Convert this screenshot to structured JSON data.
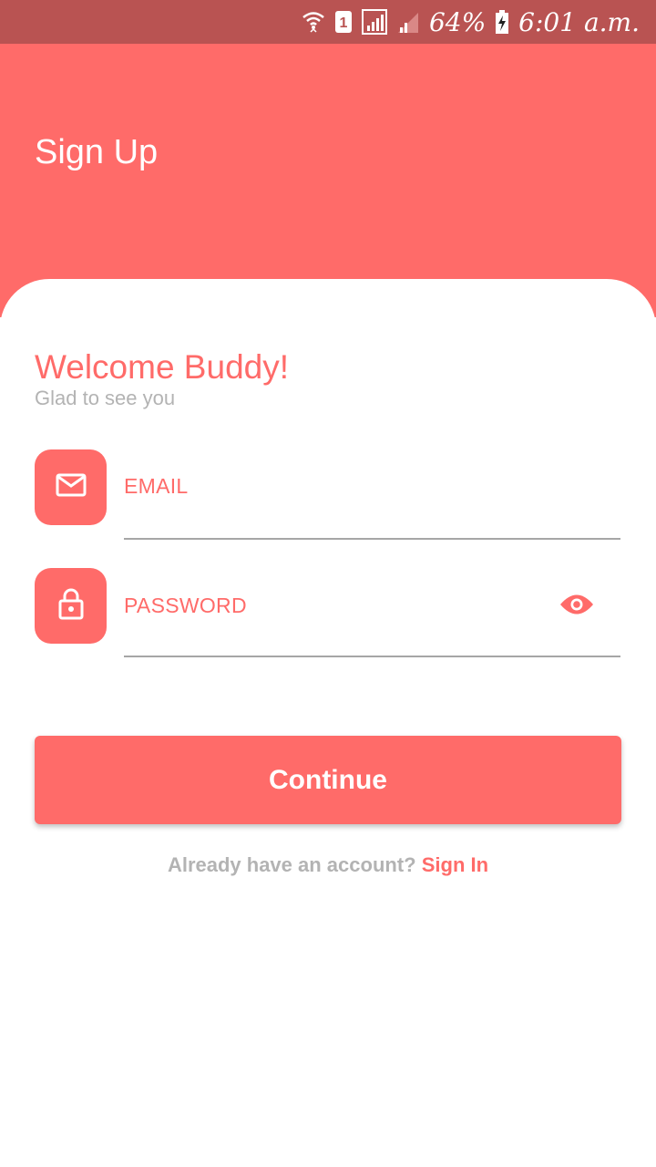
{
  "status_bar": {
    "battery": "64%",
    "time": "6:01 a.m.",
    "sim_slot": "1",
    "icons": [
      "wifi-icon",
      "sim-icon",
      "signal-icon",
      "signal-icon",
      "battery-charging-icon"
    ]
  },
  "header": {
    "title": "Sign Up"
  },
  "card": {
    "welcome": "Welcome Buddy!",
    "subtitle": "Glad to see you"
  },
  "form": {
    "email": {
      "label": "EMAIL",
      "icon": "mail-icon"
    },
    "password": {
      "label": "PASSWORD",
      "icon": "lock-icon",
      "toggle_icon": "eye-icon"
    }
  },
  "actions": {
    "continue_label": "Continue"
  },
  "footer": {
    "question": "Already have an account?",
    "sign_in_label": "Sign In"
  },
  "colors": {
    "accent": "#ff6b69",
    "status_bar": "#b95352",
    "muted_text": "#b3b3b3",
    "underline": "#a6a6a6"
  }
}
